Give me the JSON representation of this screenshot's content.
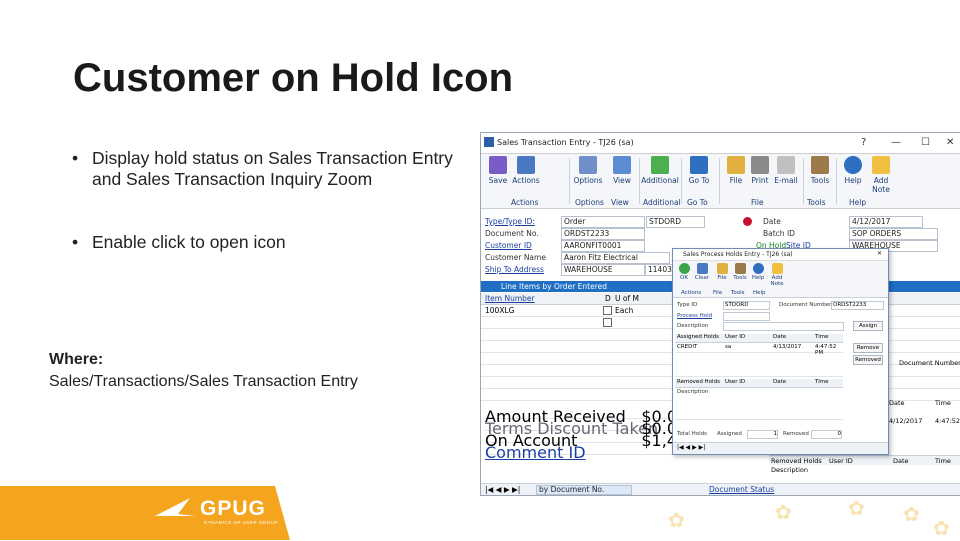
{
  "slide": {
    "title": "Customer on Hold Icon",
    "bullets": [
      "Display hold status on Sales Transaction Entry and Sales Transaction Inquiry Zoom",
      "Enable click to open icon"
    ],
    "where_heading": "Where:",
    "where_path": "Sales/Transactions/Sales Transaction Entry",
    "bullet_char": "•"
  },
  "window": {
    "title": "Sales Transaction Entry  -  TJ26 (sa)",
    "controls": [
      "?",
      "—",
      "☐",
      "✕"
    ],
    "ribbon_buttons": [
      "Save",
      "Actions",
      "Options",
      "View",
      "Additional",
      "Go To",
      "File",
      "Print",
      "E-mail",
      "Tools",
      "Help",
      "Add Note"
    ],
    "ribbon_groups": [
      "Actions",
      "Options",
      "View",
      "Additional",
      "Go To",
      "File",
      "Tools",
      "Help"
    ],
    "fields": {
      "type_label": "Type/Type ID:",
      "type_value": "Order",
      "type_id": "STDORD",
      "doc_label": "Document No.",
      "doc_value": "ORDST2233",
      "customer_label": "Customer ID",
      "customer_value": "AARONFIT0001",
      "customer_name_label": "Customer Name",
      "customer_name_value": "Aaron Fitz Electrical",
      "ship_label": "Ship To Address",
      "ship_value": "WAREHOUSE",
      "ship_addr": "11403 45 St",
      "date_label": "Date",
      "date_value": "4/12/2017",
      "batch_label": "Batch ID",
      "batch_value": "SOP ORDERS",
      "onhold_label": "On Hold",
      "site_label": "Site ID",
      "site_value": "WAREHOUSE"
    },
    "grid": {
      "header": "Line Items by Order Entered",
      "col_item": "Item Number",
      "col_d": "D",
      "col_uofm": "U of M",
      "rows": [
        {
          "item": "100XLG",
          "uofm": "Each"
        }
      ]
    },
    "totals": [
      {
        "label": "Amount Received",
        "value": "$0.0"
      },
      {
        "label": "Terms Discount Taken",
        "value": "$0.0"
      },
      {
        "label": "On Account",
        "value": "$1,4"
      },
      {
        "label": "Comment ID",
        "value": ""
      }
    ],
    "status_bar": {
      "sort": "by Document No.",
      "link": "Document Status"
    },
    "popup": {
      "title": "Sales Process Holds Entry  -  TJ26 (sa)",
      "buttons": [
        "OK",
        "Clear",
        "File",
        "Tools",
        "Help",
        "Add Note"
      ],
      "groups": [
        "Actions",
        "File",
        "Tools",
        "Help"
      ],
      "type_label": "Type ID",
      "type_value": "STDORD",
      "docnum_label": "Document Number",
      "docnum_value": "ORDST2233",
      "process_hold_label": "Process Hold",
      "description_label": "Description",
      "assign_btn": "Assign",
      "assigned_table": [
        "Assigned Holds",
        "User ID",
        "Date",
        "Time"
      ],
      "assigned_row": [
        "CREDIT",
        "sa",
        "4/13/2017",
        "4:47:52 PM"
      ],
      "remove_btn": "Remove",
      "removed_btn": "Removed",
      "removed_table": [
        "Removed Holds",
        "User ID",
        "Date",
        "Time"
      ],
      "total_holds": "Total Holds",
      "assigned_label": "Assigned",
      "assigned_count": "1",
      "removed_label": "Removed",
      "removed_count": "0"
    },
    "right_panel": {
      "doc_number_label": "Document Number",
      "date_label": "Date",
      "time_label": "Time",
      "row_date": "4/12/2017",
      "row_time": "4:47:52",
      "removed_holds": "Removed Holds",
      "user_id": "User ID",
      "description": "Description"
    }
  },
  "logo": {
    "text": "GPUG",
    "subtitle": "DYNAMICS GP USER GROUP"
  },
  "colors": {
    "accent": "#1f6fc5",
    "logo_orange": "#f5a51d",
    "hold_red": "#c8102e"
  }
}
